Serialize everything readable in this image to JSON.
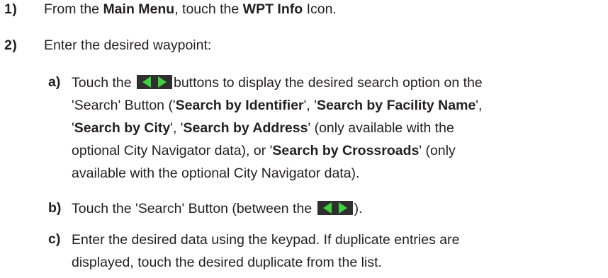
{
  "step1": {
    "number": "1)",
    "t1": "From the ",
    "b1": "Main Menu",
    "t2": ", touch the ",
    "b2": "WPT Info",
    "t3": " Icon."
  },
  "step2": {
    "number": "2)",
    "text": "Enter the desired waypoint:"
  },
  "sub_a": {
    "letter": "a)",
    "l1_t1": "Touch the",
    "l1_t2": "buttons to display the desired search option on the",
    "l2_t1": "'Search' Button ('",
    "l2_b1": "Search by Identifier",
    "l2_t2": "', '",
    "l2_b2": "Search by Facility Name",
    "l2_t3": "',",
    "l3_t1": "'",
    "l3_b1": "Search by City",
    "l3_t2": "',  '",
    "l3_b2": "Search by Address",
    "l3_t3": "' (only available with the",
    "l4_t1": "optional City Navigator data), or '",
    "l4_b1": "Search by Crossroads",
    "l4_t2": "' (only",
    "l5": "available with the optional City Navigator data)."
  },
  "sub_b": {
    "letter": "b)",
    "t1": "Touch the 'Search' Button (between the",
    "t2": ")."
  },
  "sub_c": {
    "letter": "c)",
    "l1": "Enter the desired data using the keypad.  If duplicate entries are",
    "l2": "displayed, touch the desired duplicate from the list."
  },
  "icons": {
    "arrow_buttons": "left-right-arrow-buttons-icon",
    "button_bg": "#2f2f2f",
    "arrow_color": "#3fd13f"
  }
}
